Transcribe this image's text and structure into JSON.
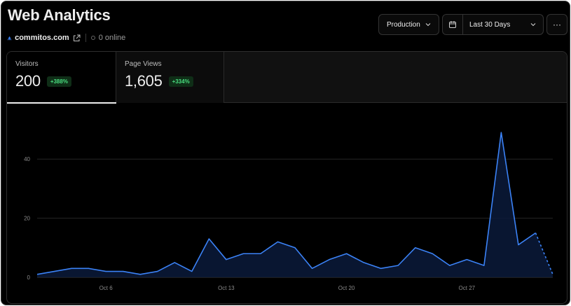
{
  "header": {
    "title": "Web Analytics",
    "domain": "commitos.com",
    "online": "0 online"
  },
  "toolbar": {
    "environment": "Production",
    "date_range": "Last 30 Days",
    "more": "···"
  },
  "tabs": [
    {
      "label": "Visitors",
      "value": "200",
      "change": "+388%",
      "active": true
    },
    {
      "label": "Page Views",
      "value": "1,605",
      "change": "+334%",
      "active": false
    }
  ],
  "colors": {
    "accent": "#3b82f6",
    "positive": "#4ade80",
    "background": "#000000"
  },
  "chart_data": {
    "type": "area",
    "xlabel": "",
    "ylabel": "",
    "ylim": [
      0,
      50
    ],
    "yticks": [
      0,
      20,
      40
    ],
    "x_tick_labels": [
      "Oct 6",
      "Oct 13",
      "Oct 20",
      "Oct 27"
    ],
    "x_tick_index": [
      4,
      11,
      18,
      25
    ],
    "grid": true,
    "series": [
      {
        "values": [
          1,
          2,
          3,
          3,
          2,
          2,
          1,
          2,
          5,
          2,
          13,
          6,
          8,
          8,
          12,
          10,
          3,
          6,
          8,
          5,
          3,
          4,
          10,
          8,
          4,
          6,
          4,
          49,
          11,
          15,
          1
        ],
        "partial_last_segment": true
      }
    ]
  }
}
